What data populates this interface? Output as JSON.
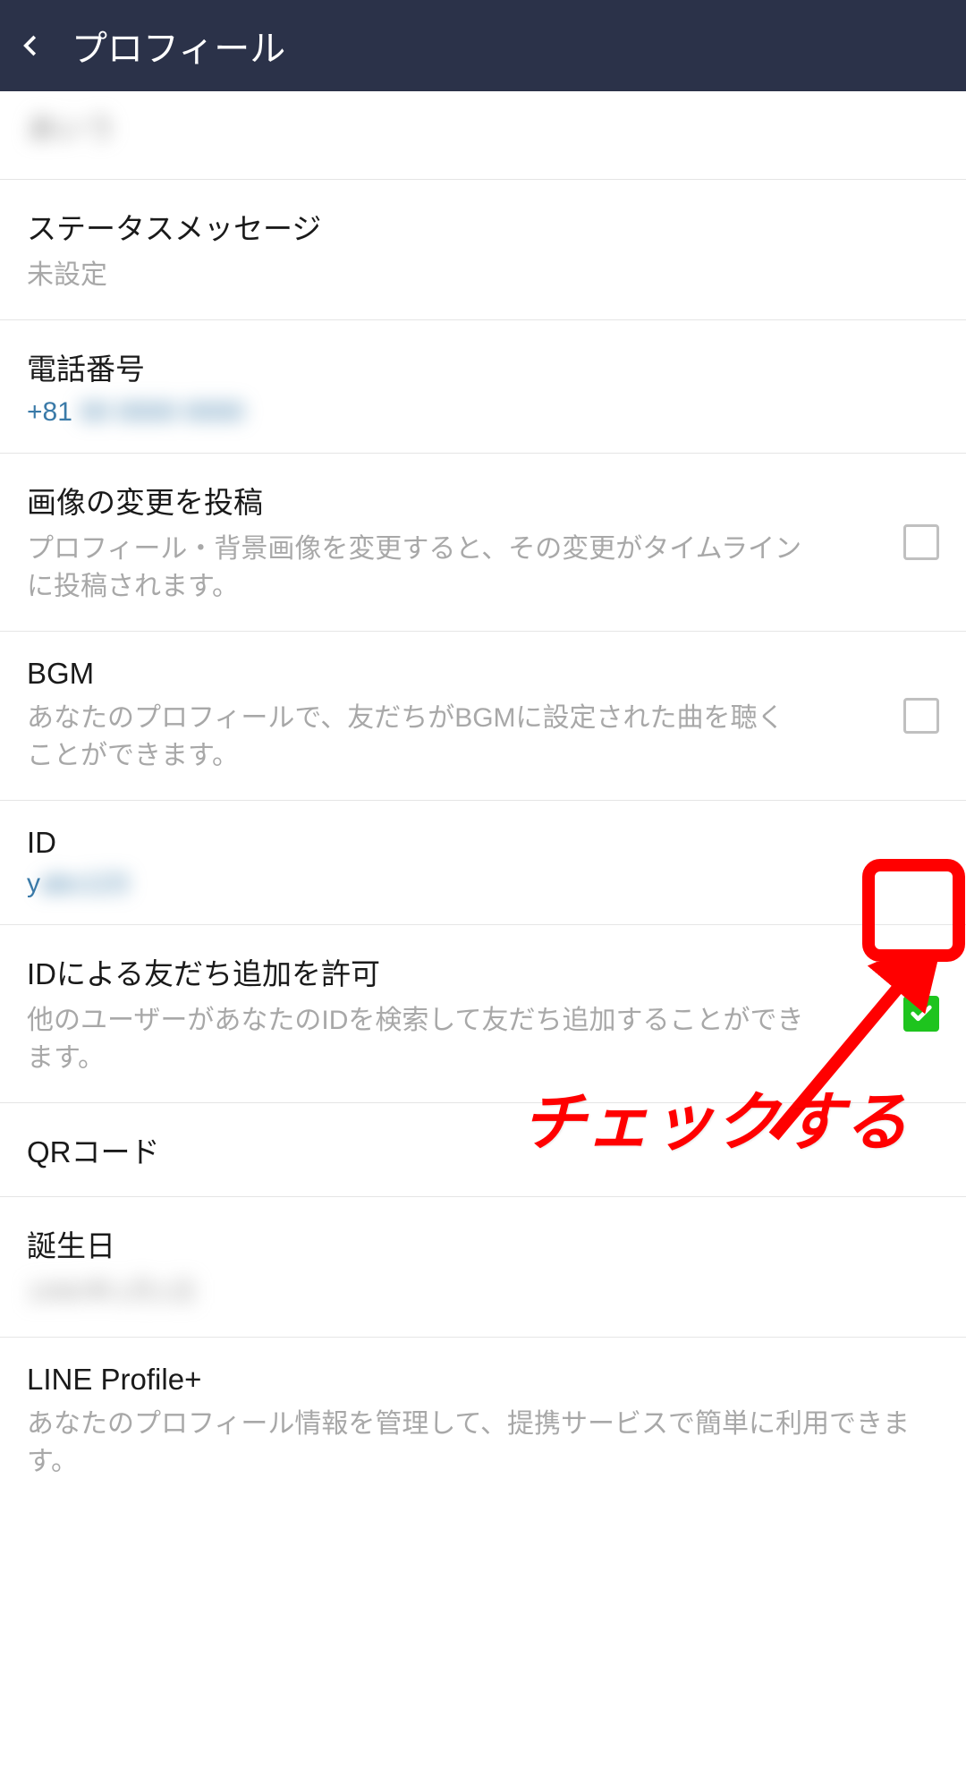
{
  "header": {
    "title": "プロフィール"
  },
  "items": {
    "name": {
      "value": ""
    },
    "statusMessage": {
      "title": "ステータスメッセージ",
      "subtitle": "未設定"
    },
    "phone": {
      "title": "電話番号",
      "value": "+81"
    },
    "postImage": {
      "title": "画像の変更を投稿",
      "subtitle": "プロフィール・背景画像を変更すると、その変更がタイムラインに投稿されます。"
    },
    "bgm": {
      "title": "BGM",
      "subtitle": "あなたのプロフィールで、友だちがBGMに設定された曲を聴くことができます。"
    },
    "id": {
      "title": "ID",
      "value": "y"
    },
    "allowAdd": {
      "title": "IDによる友だち追加を許可",
      "subtitle": "他のユーザーがあなたのIDを検索して友だち追加することができます。"
    },
    "qr": {
      "title": "QRコード"
    },
    "birthday": {
      "title": "誕生日",
      "value": ""
    },
    "profilePlus": {
      "title": "LINE Profile+",
      "subtitle": "あなたのプロフィール情報を管理して、提携サービスで簡単に利用できます。"
    }
  },
  "annotation": {
    "text": "チェックする"
  }
}
